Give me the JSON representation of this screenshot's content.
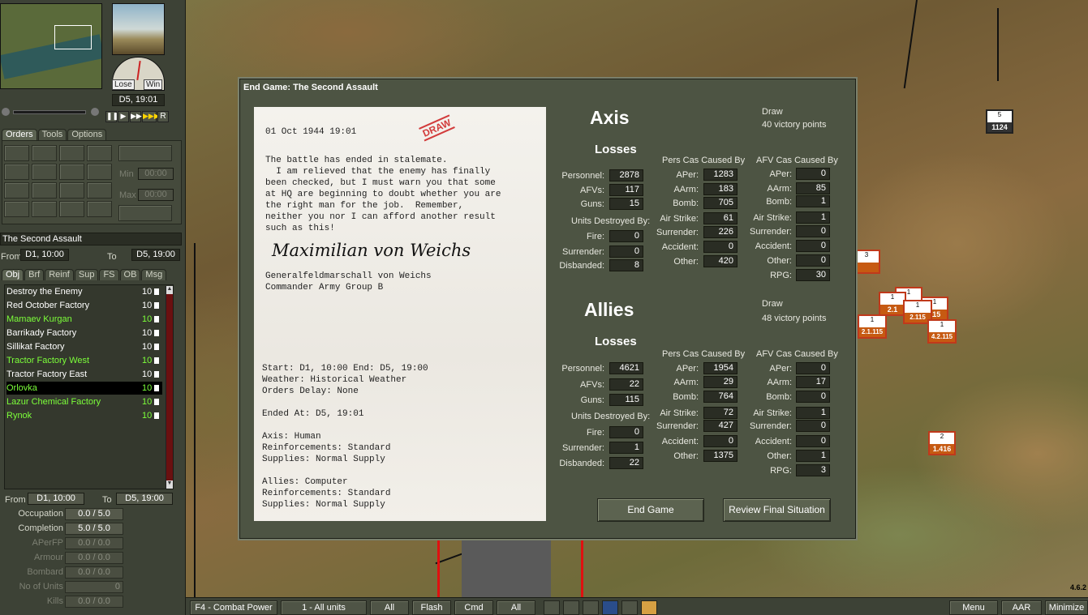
{
  "top_panel": {
    "gauge_lose": "Lose",
    "gauge_win": "Win",
    "current_turn": "D5, 19:01",
    "play_r": "R"
  },
  "tabs": [
    "Orders",
    "Tools",
    "Options"
  ],
  "orders": {
    "min_label": "Min",
    "min_value": "00:00",
    "max_label": "Max",
    "max_value": "00:00"
  },
  "scenario": {
    "name": "The Second Assault",
    "from_label": "From",
    "from": "D1, 10:00",
    "to_label": "To",
    "to": "D5, 19:00"
  },
  "sub_tabs": [
    "Obj",
    "Brf",
    "Reinf",
    "Sup",
    "FS",
    "OB",
    "Msg"
  ],
  "objectives": [
    {
      "name": "Destroy the Enemy",
      "value": "10",
      "color": "#ffffff"
    },
    {
      "name": "Red October Factory",
      "value": "10",
      "color": "#ffffff"
    },
    {
      "name": "Mamaev Kurgan",
      "value": "10",
      "color": "#7cff3a"
    },
    {
      "name": "Barrikady Factory",
      "value": "10",
      "color": "#ffffff"
    },
    {
      "name": "Sillikat Factory",
      "value": "10",
      "color": "#ffffff"
    },
    {
      "name": "Tractor Factory West",
      "value": "10",
      "color": "#7cff3a"
    },
    {
      "name": "Tractor Factory East",
      "value": "10",
      "color": "#ffffff"
    },
    {
      "name": "Orlovka",
      "value": "10",
      "color": "#7cff3a"
    },
    {
      "name": "Lazur Chemical Factory",
      "value": "10",
      "color": "#7cff3a"
    },
    {
      "name": "Rynok",
      "value": "10",
      "color": "#7cff3a"
    }
  ],
  "objective_detail": {
    "from_label": "From",
    "from": "D1, 10:00",
    "to_label": "To",
    "to": "D5, 19:00",
    "stats": [
      {
        "label": "Occupation",
        "value": "0.0 / 5.0",
        "dim": false
      },
      {
        "label": "Completion",
        "value": "5.0 / 5.0",
        "dim": false
      },
      {
        "label": "APerFP",
        "value": "0.0 / 0.0",
        "dim": true
      },
      {
        "label": "Armour",
        "value": "0.0 / 0.0",
        "dim": true
      },
      {
        "label": "Bombard",
        "value": "0.0 / 0.0",
        "dim": true
      },
      {
        "label": "No of Units",
        "value": "0",
        "dim": true
      },
      {
        "label": "Kills",
        "value": "0.0 / 0.0",
        "dim": true
      }
    ]
  },
  "bottom_bar": {
    "combat_power": "F4 - Combat Power",
    "units_filter": "1 - All units",
    "all1": "All",
    "flash": "Flash",
    "cmd": "Cmd",
    "all2": "All",
    "menu": "Menu",
    "aar": "AAR",
    "minimize": "Minimize",
    "version": "4.6.2"
  },
  "counters": [
    {
      "top": "5",
      "num": "1124"
    },
    {
      "top": "3",
      "num": ""
    },
    {
      "top": "1",
      "num": "115"
    },
    {
      "top": "1",
      "num": "2.1"
    },
    {
      "top": "1",
      "num": "115"
    },
    {
      "top": "1",
      "num": "2.1.115"
    },
    {
      "top": "1",
      "num": "2.115"
    },
    {
      "top": "1",
      "num": "4.2.115"
    },
    {
      "top": "2",
      "num": "1.416"
    }
  ],
  "dialog": {
    "title": "End Game: The Second Assault",
    "letter": {
      "date": "01 Oct 1944 19:01",
      "stamp": "DRAW",
      "body": "The battle has ended in stalemate.\n  I am relieved that the enemy has finally\nbeen checked, but I must warn you that some\nat HQ are beginning to doubt whether you are\nthe right man for the job.  Remember,\nneither you nor I can afford another result\nsuch as this!",
      "signature": "Maximilian von Weichs",
      "signer": "Generalfeldmarschall von Weichs\nCommander Army Group B",
      "summary": "Start: D1, 10:00 End: D5, 19:00\nWeather: Historical Weather\nOrders Delay: None\n\nEnded At: D5, 19:01\n\nAxis: Human\nReinforcements: Standard\nSupplies: Normal Supply\n\nAllies: Computer\nReinforcements: Standard\nSupplies: Normal Supply"
    },
    "axis": {
      "name": "Axis",
      "result": "Draw",
      "vp": "40 victory points",
      "losses_label": "Losses",
      "losses": [
        {
          "l": "Personnel:",
          "v": "2878"
        },
        {
          "l": "AFVs:",
          "v": "117"
        },
        {
          "l": "Guns:",
          "v": "15"
        }
      ],
      "udb_label": "Units Destroyed By:",
      "destroyed": [
        {
          "l": "Fire:",
          "v": "0"
        },
        {
          "l": "Surrender:",
          "v": "0"
        },
        {
          "l": "Disbanded:",
          "v": "8"
        }
      ],
      "pers_label": "Pers Cas Caused By",
      "pers": [
        {
          "l": "APer:",
          "v": "1283"
        },
        {
          "l": "AArm:",
          "v": "183"
        },
        {
          "l": "Bomb:",
          "v": "705"
        },
        {
          "l": "Air Strike:",
          "v": "61"
        },
        {
          "l": "Surrender:",
          "v": "226"
        },
        {
          "l": "Accident:",
          "v": "0"
        },
        {
          "l": "Other:",
          "v": "420"
        }
      ],
      "afv_label": "AFV Cas Caused By",
      "afv": [
        {
          "l": "APer:",
          "v": "0"
        },
        {
          "l": "AArm:",
          "v": "85"
        },
        {
          "l": "Bomb:",
          "v": "1"
        },
        {
          "l": "Air Strike:",
          "v": "1"
        },
        {
          "l": "Surrender:",
          "v": "0"
        },
        {
          "l": "Accident:",
          "v": "0"
        },
        {
          "l": "Other:",
          "v": "0"
        },
        {
          "l": "RPG:",
          "v": "30"
        }
      ]
    },
    "allies": {
      "name": "Allies",
      "result": "Draw",
      "vp": "48 victory points",
      "losses_label": "Losses",
      "losses": [
        {
          "l": "Personnel:",
          "v": "4621"
        },
        {
          "l": "AFVs:",
          "v": "22"
        },
        {
          "l": "Guns:",
          "v": "115"
        }
      ],
      "udb_label": "Units Destroyed By:",
      "destroyed": [
        {
          "l": "Fire:",
          "v": "0"
        },
        {
          "l": "Surrender:",
          "v": "1"
        },
        {
          "l": "Disbanded:",
          "v": "22"
        }
      ],
      "pers_label": "Pers Cas Caused By",
      "pers": [
        {
          "l": "APer:",
          "v": "1954"
        },
        {
          "l": "AArm:",
          "v": "29"
        },
        {
          "l": "Bomb:",
          "v": "764"
        },
        {
          "l": "Air Strike:",
          "v": "72"
        },
        {
          "l": "Surrender:",
          "v": "427"
        },
        {
          "l": "Accident:",
          "v": "0"
        },
        {
          "l": "Other:",
          "v": "1375"
        }
      ],
      "afv_label": "AFV Cas Caused By",
      "afv": [
        {
          "l": "APer:",
          "v": "0"
        },
        {
          "l": "AArm:",
          "v": "17"
        },
        {
          "l": "Bomb:",
          "v": "0"
        },
        {
          "l": "Air Strike:",
          "v": "1"
        },
        {
          "l": "Surrender:",
          "v": "0"
        },
        {
          "l": "Accident:",
          "v": "0"
        },
        {
          "l": "Other:",
          "v": "1"
        },
        {
          "l": "RPG:",
          "v": "3"
        }
      ]
    },
    "end_game_label": "End Game",
    "review_label": "Review Final Situation"
  }
}
